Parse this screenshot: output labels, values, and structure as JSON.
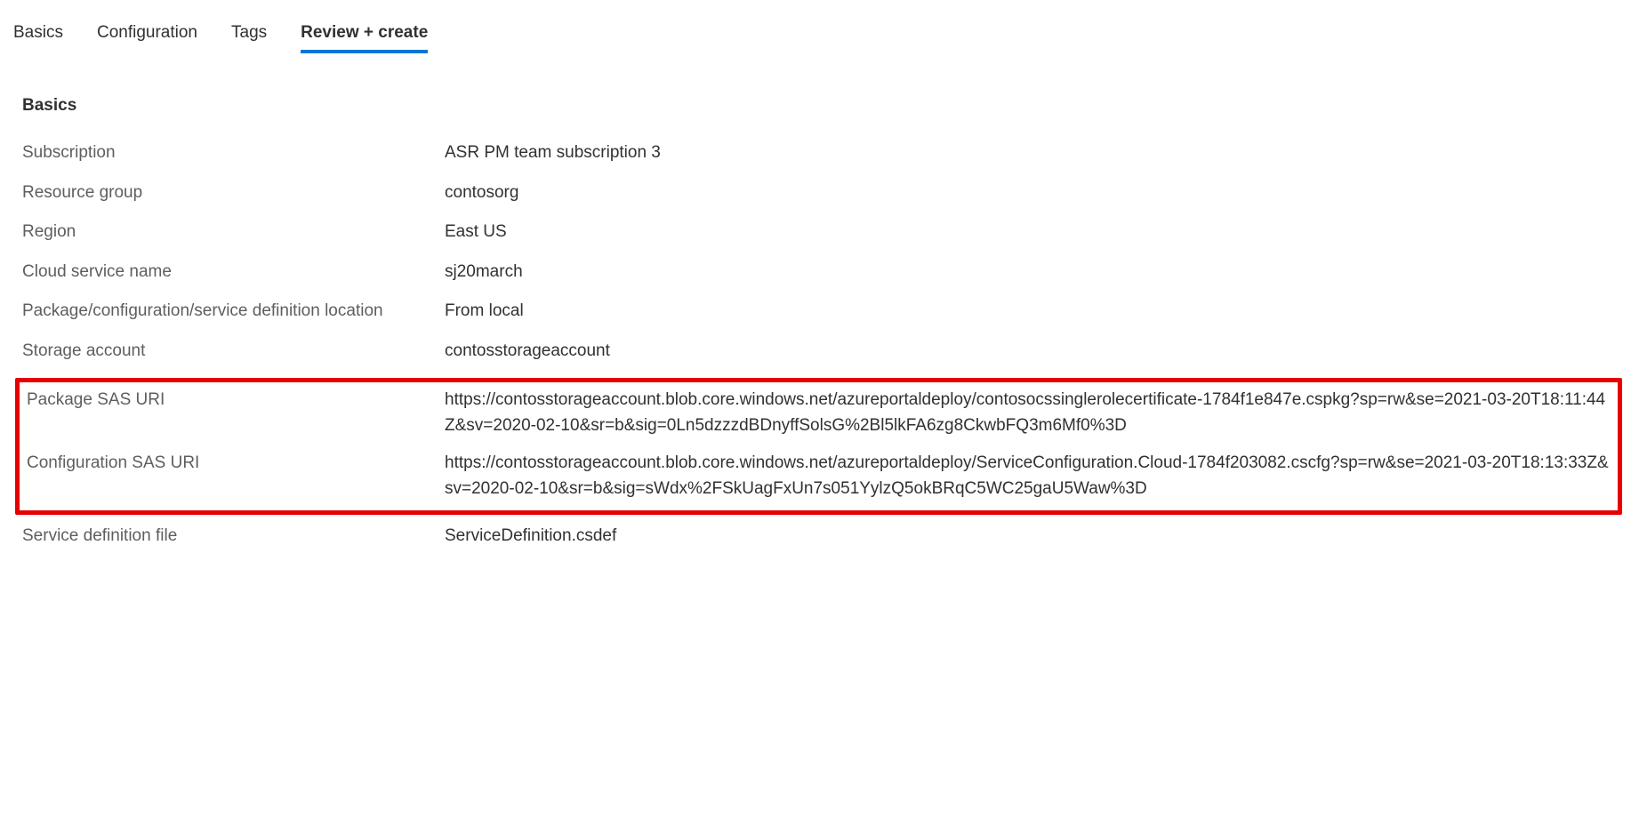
{
  "tabs": {
    "basics": "Basics",
    "configuration": "Configuration",
    "tags": "Tags",
    "review_create": "Review + create"
  },
  "section": {
    "heading": "Basics",
    "fields": {
      "subscription": {
        "label": "Subscription",
        "value": "ASR PM team subscription 3"
      },
      "resource_group": {
        "label": "Resource group",
        "value": "contosorg"
      },
      "region": {
        "label": "Region",
        "value": "East US"
      },
      "cloud_service_name": {
        "label": "Cloud service name",
        "value": "sj20march"
      },
      "package_location": {
        "label": "Package/configuration/service definition location",
        "value": "From local"
      },
      "storage_account": {
        "label": "Storage account",
        "value": "contosstorageaccount"
      },
      "package_sas_uri": {
        "label": "Package SAS URI",
        "value": "https://contosstorageaccount.blob.core.windows.net/azureportaldeploy/contosocssinglerolecertificate-1784f1e847e.cspkg?sp=rw&se=2021-03-20T18:11:44Z&sv=2020-02-10&sr=b&sig=0Ln5dzzzdBDnyffSolsG%2Bl5lkFA6zg8CkwbFQ3m6Mf0%3D"
      },
      "configuration_sas_uri": {
        "label": "Configuration SAS URI",
        "value": "https://contosstorageaccount.blob.core.windows.net/azureportaldeploy/ServiceConfiguration.Cloud-1784f203082.cscfg?sp=rw&se=2021-03-20T18:13:33Z&sv=2020-02-10&sr=b&sig=sWdx%2FSkUagFxUn7s051YylzQ5okBRqC5WC25gaU5Waw%3D"
      },
      "service_definition_file": {
        "label": "Service definition file",
        "value": "ServiceDefinition.csdef"
      }
    }
  }
}
